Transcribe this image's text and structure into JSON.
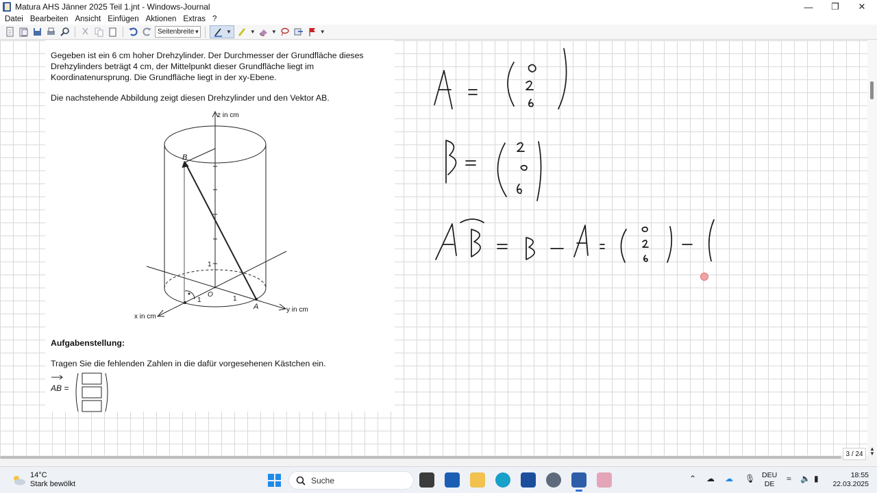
{
  "window": {
    "title": "Matura AHS Jänner 2025 Teil 1.jnt - Windows-Journal"
  },
  "menu": [
    "Datei",
    "Bearbeiten",
    "Ansicht",
    "Einfügen",
    "Aktionen",
    "Extras",
    "?"
  ],
  "toolbar": {
    "zoom_value": "Seitenbreite"
  },
  "document": {
    "para1": "Gegeben ist ein 6 cm hoher Drehzylinder. Der Durchmesser der Grundfläche dieses Drehzylinders beträgt 4 cm, der Mittelpunkt dieser Grundfläche liegt im Koordinatenursprung. Die Grundfläche liegt in der xy-Ebene.",
    "para2": "Die nachstehende Abbildung zeigt diesen Drehzylinder und den Vektor AB.",
    "heading": "Aufgabenstellung:",
    "task": "Tragen Sie die fehlenden Zahlen in die dafür vorgesehenen Kästchen ein.",
    "answer_label": "AB =",
    "figure": {
      "z_label": "z in cm",
      "y_label": "y in cm",
      "x_label": "x in cm",
      "point_a": "A",
      "point_b": "B",
      "origin": "O",
      "tick_1": "1"
    }
  },
  "page_indicator": "3 / 24",
  "taskbar": {
    "weather_temp": "14°C",
    "weather_desc": "Stark bewölkt",
    "search_label": "Suche",
    "lang_top": "DEU",
    "lang_bottom": "DE",
    "time": "18:55",
    "date": "22.03.2025"
  },
  "colors": {
    "ink": "#1a1a1a",
    "accent": "#1f8be8",
    "pen_marker": "#f0a3a3"
  }
}
